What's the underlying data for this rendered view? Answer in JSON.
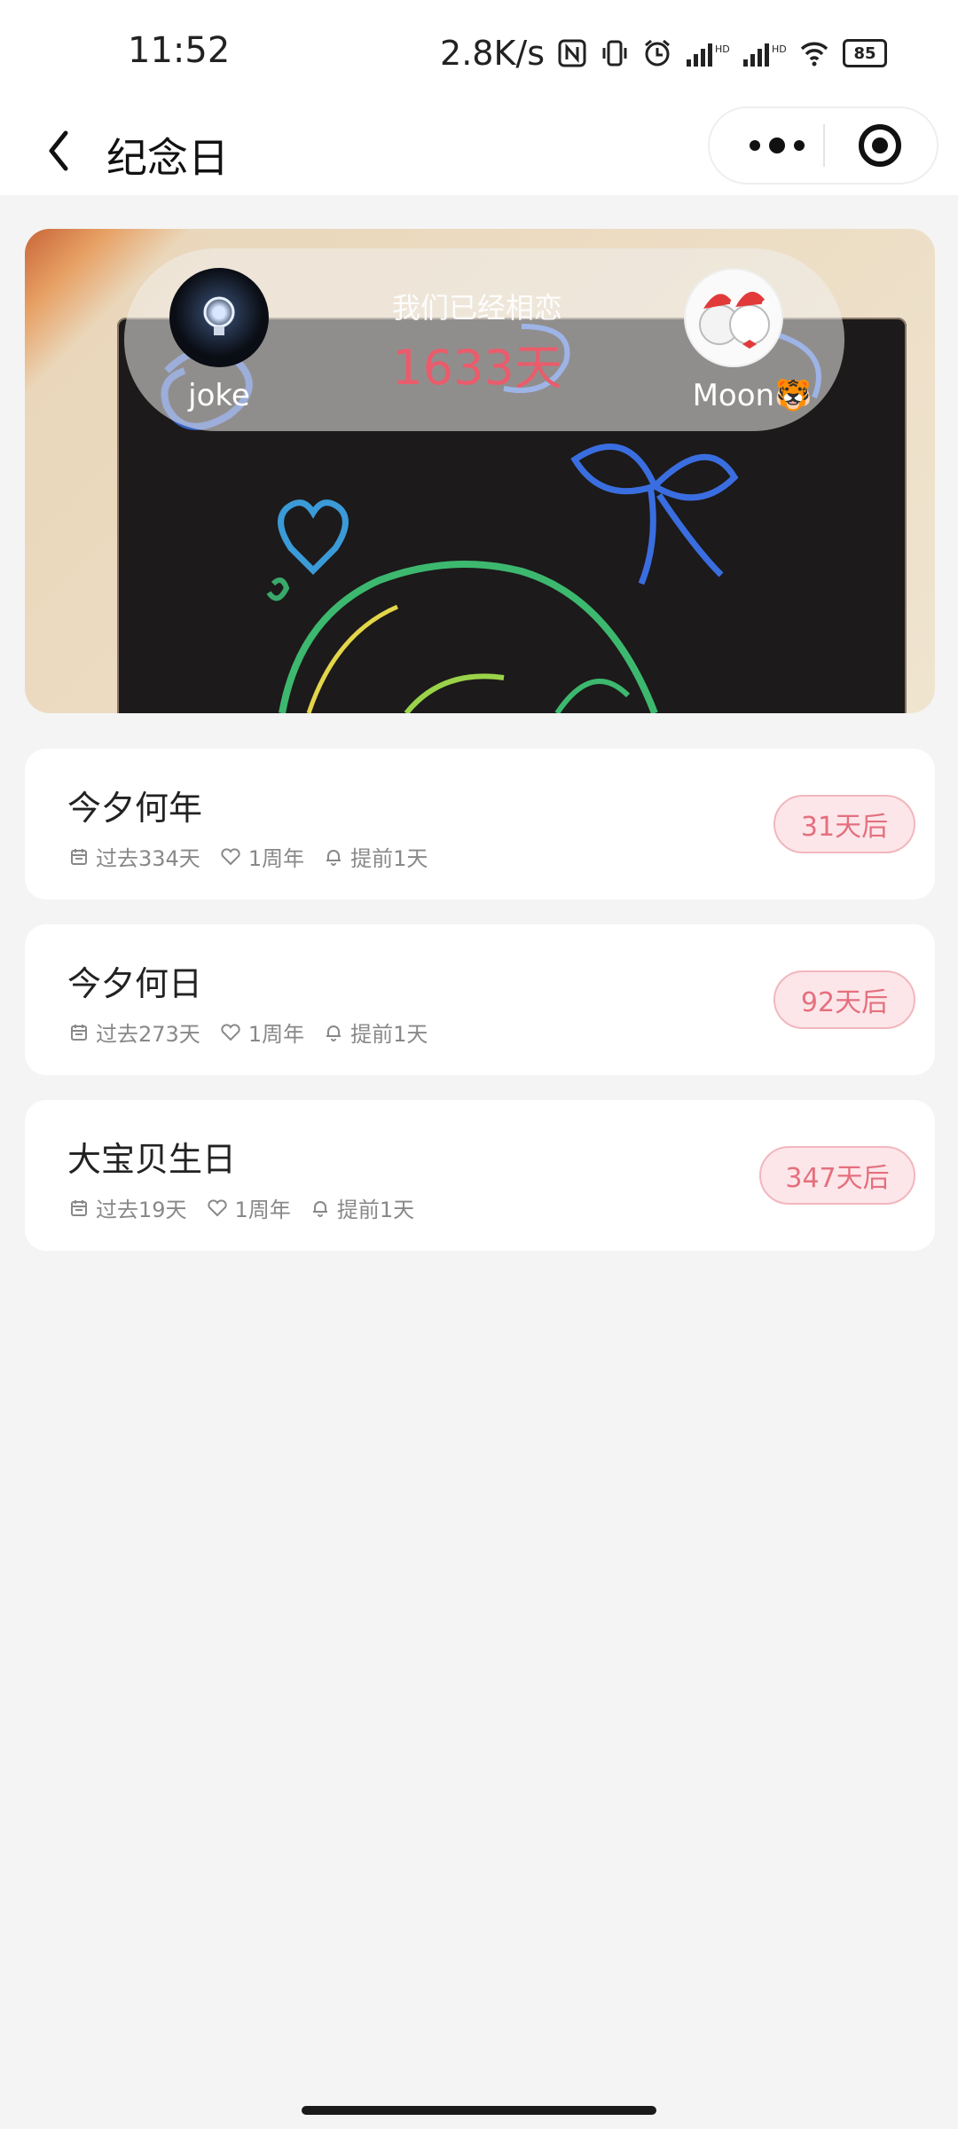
{
  "status_bar": {
    "time": "11:52",
    "net_speed": "2.8K/s",
    "battery": "85",
    "icons": [
      "nfc-icon",
      "vibrate-icon",
      "alarm-icon",
      "signal-icon",
      "signal-icon",
      "wifi-icon",
      "battery-icon"
    ]
  },
  "nav": {
    "title": "纪念日",
    "back_icon": "chevron-left-icon",
    "more_icon": "more-dots-icon",
    "close_icon": "target-icon"
  },
  "banner": {
    "label": "我们已经相恋",
    "days": "1633天",
    "left_name": "joke",
    "right_name": "Moon🐯"
  },
  "anniversaries": [
    {
      "title": "今夕何年",
      "past": "过去334天",
      "cycle": "1周年",
      "remind": "提前1天",
      "countdown": "31天后"
    },
    {
      "title": "今夕何日",
      "past": "过去273天",
      "cycle": "1周年",
      "remind": "提前1天",
      "countdown": "92天后"
    },
    {
      "title": "大宝贝生日",
      "past": "过去19天",
      "cycle": "1周年",
      "remind": "提前1天",
      "countdown": "347天后"
    }
  ],
  "colors": {
    "accent": "#ea5c6b",
    "pill_bg": "#fde6e9",
    "page_bg": "#f4f4f4"
  }
}
